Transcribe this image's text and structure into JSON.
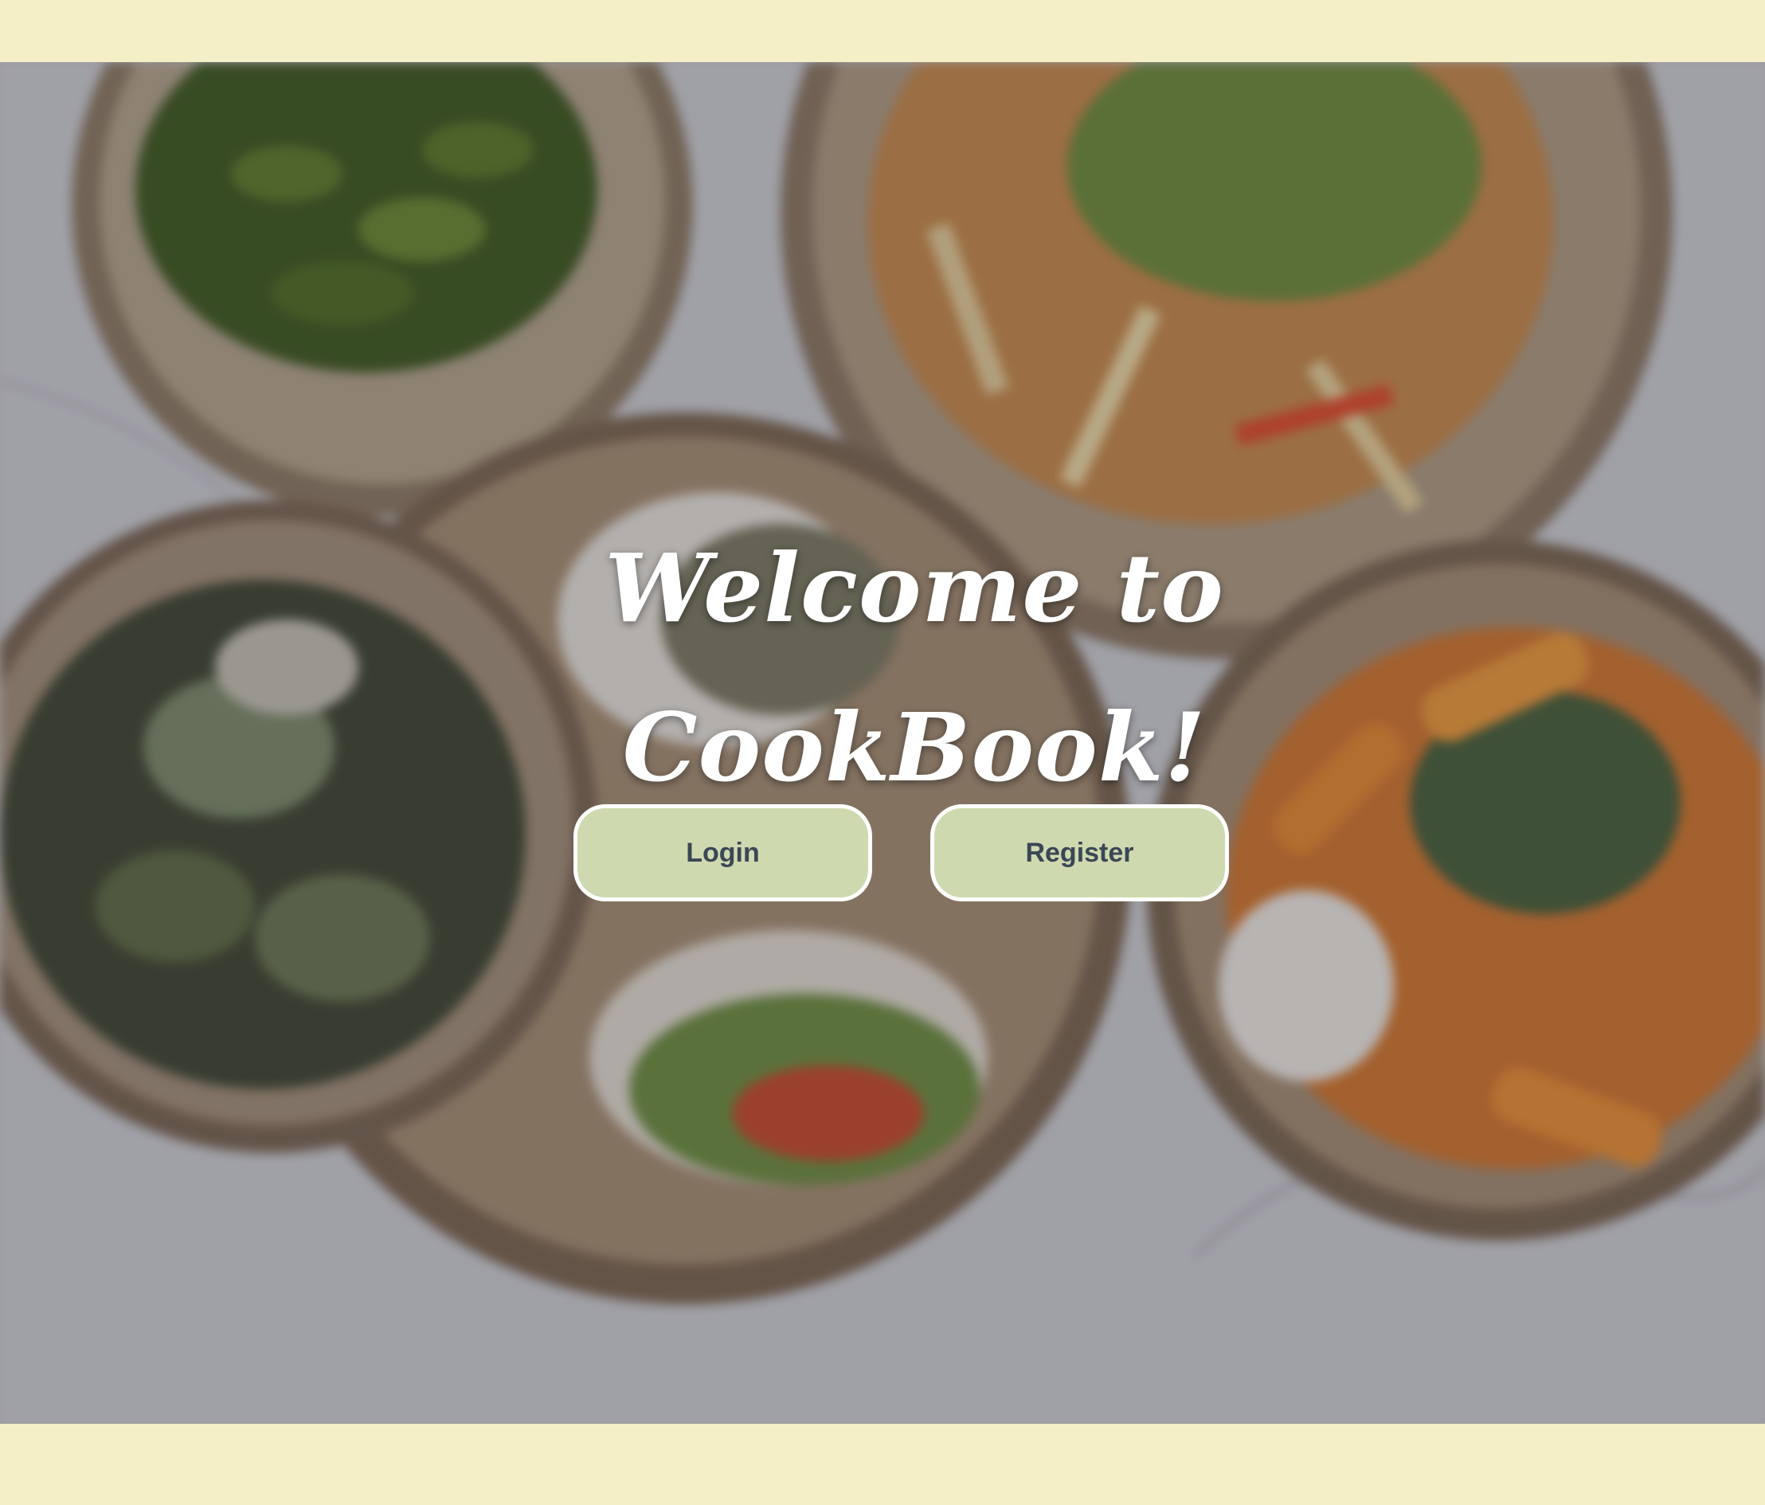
{
  "page": {
    "title_line1": "Welcome to",
    "title_line2": "CookBook!"
  },
  "actions": {
    "login_label": "Login",
    "register_label": "Register"
  },
  "colors": {
    "band": "#f4efc6",
    "button_fill": "#cfd9af",
    "button_border": "#ffffff",
    "button_text": "#3a4756",
    "title_text": "#ffffff"
  }
}
